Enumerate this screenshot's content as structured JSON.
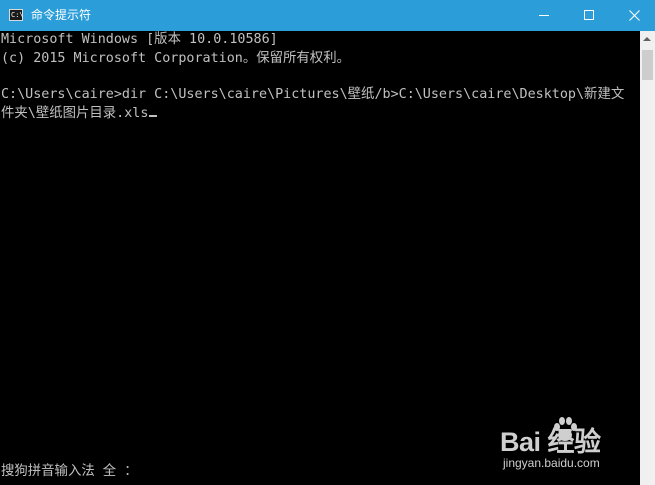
{
  "window": {
    "title": "命令提示符",
    "icon": "cmd-icon",
    "icon_glyph": "C:\\",
    "controls": [
      "minimize-icon",
      "maximize-icon",
      "close-icon"
    ]
  },
  "console": {
    "lines": [
      "Microsoft Windows [版本 10.0.10586]",
      "(c) 2015 Microsoft Corporation。保留所有权利。",
      "",
      "C:\\Users\\caire>dir C:\\Users\\caire\\Pictures\\壁纸/b>C:\\Users\\caire\\Desktop\\新建文",
      "件夹\\壁纸图片目录.xls"
    ],
    "ime_status": "搜狗拼音输入法 全 ："
  },
  "watermark": {
    "logo_text": "Bai  经验",
    "site": "jingyan.baidu.com"
  },
  "colors": {
    "titlebar": "#2b9ed9",
    "console_bg": "#000000",
    "console_text": "#c0c0c0"
  }
}
